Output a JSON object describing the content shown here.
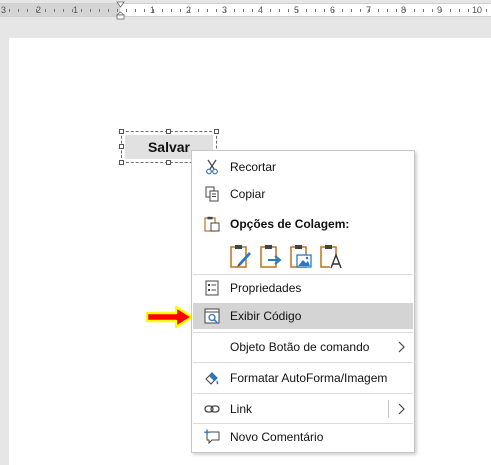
{
  "ruler": {
    "numbers": [
      "3",
      "2",
      "1",
      "1",
      "2",
      "3",
      "4",
      "5",
      "6",
      "7",
      "8",
      "9",
      "10"
    ]
  },
  "document": {
    "button_label": "Salvar"
  },
  "context_menu": {
    "items": [
      {
        "label": "Recortar",
        "icon": "scissors-icon"
      },
      {
        "label": "Copiar",
        "icon": "copy-icon"
      },
      {
        "label": "Opções de Colagem:",
        "icon": "paste-icon"
      },
      {
        "label": "Propriedades",
        "icon": "properties-icon"
      },
      {
        "label": "Exibir Código",
        "icon": "view-code-icon",
        "highlighted": true
      },
      {
        "label": "Objeto Botão de comando",
        "icon": "",
        "submenu": true
      },
      {
        "label": "Formatar AutoForma/Imagem",
        "icon": "format-shape-icon"
      },
      {
        "label": "Link",
        "icon": "link-icon",
        "submenu": true
      },
      {
        "label": "Novo Comentário",
        "icon": "new-comment-icon"
      }
    ],
    "paste_options": [
      "paste-keep-formatting-icon",
      "paste-merge-formatting-icon",
      "paste-picture-icon",
      "paste-text-only-icon"
    ]
  },
  "colors": {
    "highlight": "#d4d4d4",
    "arrow_fill": "#ff0000",
    "arrow_outline": "#ffff00",
    "icon_blue": "#2b78c5",
    "icon_orange": "#c0701c"
  }
}
